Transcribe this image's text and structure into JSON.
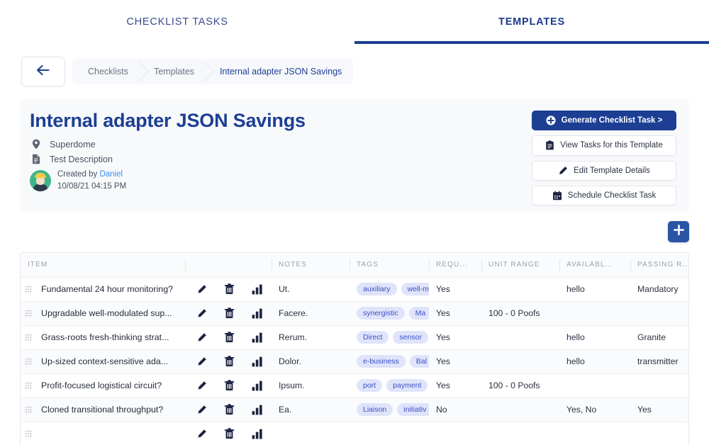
{
  "tabs": [
    {
      "label": "CHECKLIST TASKS",
      "active": false
    },
    {
      "label": "TEMPLATES",
      "active": true
    }
  ],
  "breadcrumb": {
    "back_icon": "arrow-left-icon",
    "items": [
      {
        "label": "Checklists"
      },
      {
        "label": "Templates"
      },
      {
        "label": "Internal adapter JSON Savings"
      }
    ]
  },
  "header": {
    "title": "Internal adapter JSON Savings",
    "location_icon": "map-pin-icon",
    "location": "Superdome",
    "description_icon": "document-icon",
    "description": "Test Description",
    "created_by_prefix": "Created by ",
    "created_by_user": "Daniel",
    "created_at": "10/08/21 04:15 PM",
    "buttons": [
      {
        "label": "Generate Checklist Task >",
        "icon": "plus-circle-icon",
        "primary": true
      },
      {
        "label": "View Tasks for this Template",
        "icon": "clipboard-icon",
        "primary": false
      },
      {
        "label": "Edit Template Details",
        "icon": "pencil-icon",
        "primary": false
      },
      {
        "label": "Schedule Checklist Task",
        "icon": "calendar-icon",
        "primary": false
      }
    ]
  },
  "add_button": {
    "icon": "plus-icon",
    "label": ""
  },
  "table": {
    "columns": [
      {
        "label": "ITEM"
      },
      {
        "label": ""
      },
      {
        "label": "NOTES"
      },
      {
        "label": "TAGS"
      },
      {
        "label": "REQU..."
      },
      {
        "label": "UNIT RANGE"
      },
      {
        "label": "AVAILABL..."
      },
      {
        "label": "PASSING R..."
      }
    ],
    "row_icons": [
      "pencil-icon",
      "trash-icon",
      "bar-chart-icon"
    ],
    "rows": [
      {
        "item": "Fundamental 24 hour monitoring?",
        "notes": "Ut.",
        "tags": [
          "auxiliary",
          "well-m"
        ],
        "required": "Yes",
        "unit_range": "",
        "available": "hello",
        "passing": "Mandatory"
      },
      {
        "item": "Upgradable well-modulated sup...",
        "notes": "Facere.",
        "tags": [
          "synergistic",
          "Ma"
        ],
        "required": "Yes",
        "unit_range": "100 - 0 Poofs",
        "available": "",
        "passing": ""
      },
      {
        "item": "Grass-roots fresh-thinking strat...",
        "notes": "Rerum.",
        "tags": [
          "Direct",
          "sensor"
        ],
        "required": "Yes",
        "unit_range": "",
        "available": "hello",
        "passing": "Granite"
      },
      {
        "item": "Up-sized context-sensitive ada...",
        "notes": "Dolor.",
        "tags": [
          "e-business",
          "Bal"
        ],
        "required": "Yes",
        "unit_range": "",
        "available": "hello",
        "passing": "transmitter"
      },
      {
        "item": "Profit-focused logistical circuit?",
        "notes": "Ipsum.",
        "tags": [
          "port",
          "payment"
        ],
        "required": "Yes",
        "unit_range": "100 - 0 Poofs",
        "available": "",
        "passing": ""
      },
      {
        "item": "Cloned transitional throughput?",
        "notes": "Ea.",
        "tags": [
          "Liaison",
          "initiativ"
        ],
        "required": "No",
        "unit_range": "",
        "available": "Yes, No",
        "passing": "Yes"
      },
      {
        "item": "",
        "notes": "",
        "tags": [
          "",
          ""
        ],
        "required": "",
        "unit_range": "",
        "available": "",
        "passing": ""
      }
    ]
  },
  "colors": {
    "primary": "#1c3f94",
    "accent": "#2a55a6",
    "tag_bg": "#dfe4fb",
    "tag_text": "#3c4fc4",
    "card_bg": "#f8f9fb",
    "link": "#3b8ff0"
  }
}
